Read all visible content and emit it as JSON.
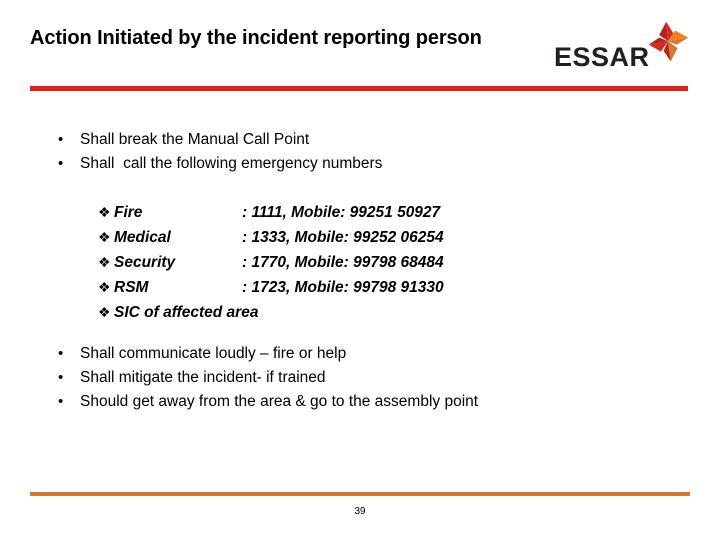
{
  "slide": {
    "title": "Action Initiated by the incident reporting person",
    "page_number": "39",
    "accent_red": "#e41d1d",
    "accent_orange": "#d9782d"
  },
  "logo": {
    "wordmark": "ESSAR",
    "mark_name": "essar-pinwheel-mark",
    "mark_colors": {
      "red": "#d32d1f",
      "dark_red": "#b3261b",
      "orange": "#ef8120",
      "dark_orange": "#d9782d"
    }
  },
  "bullets_top": [
    {
      "marker": "•",
      "text": "Shall break the Manual Call Point"
    },
    {
      "marker": "•",
      "text": "Shall  call the following emergency numbers"
    }
  ],
  "emergency_contacts": [
    {
      "marker": "❖",
      "label": "Fire",
      "value": ": 1111, Mobile: 99251 50927"
    },
    {
      "marker": "❖",
      "label": "Medical",
      "value": ": 1333, Mobile: 99252 06254"
    },
    {
      "marker": "❖",
      "label": "Security",
      "value": ": 1770, Mobile: 99798 68484"
    },
    {
      "marker": "❖",
      "label": "RSM",
      "value": ": 1723, Mobile: 99798 91330"
    },
    {
      "marker": "❖",
      "label": "SIC of affected area",
      "value": ""
    }
  ],
  "bullets_bottom": [
    {
      "marker": "•",
      "text": "Shall communicate loudly – fire or help"
    },
    {
      "marker": "•",
      "text": "Shall mitigate the incident- if trained"
    },
    {
      "marker": "•",
      "text": "Should get away from the area & go to the assembly point"
    }
  ]
}
